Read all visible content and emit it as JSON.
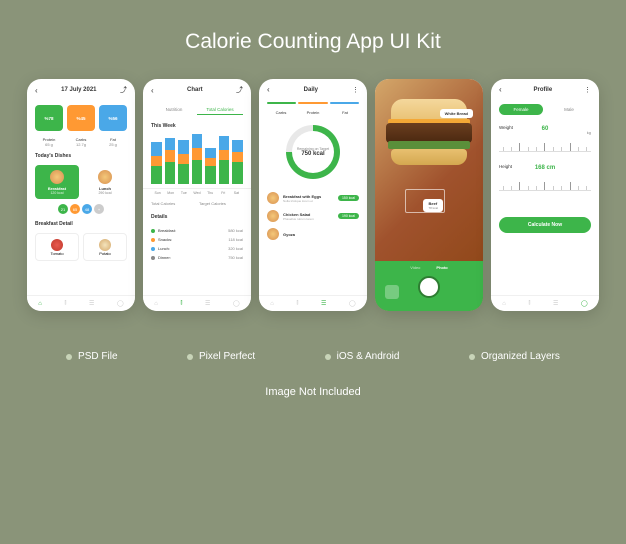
{
  "title": "Calorie Counting App UI Kit",
  "features": [
    "PSD File",
    "Pixel Perfect",
    "iOS & Android",
    "Organized Layers"
  ],
  "disclaimer": "Image Not Included",
  "screen1": {
    "date": "17 July 2021",
    "macros": [
      {
        "pct": "%78",
        "name": "Protein",
        "val": "65 g"
      },
      {
        "pct": "%45",
        "name": "Carbs",
        "val": "12.7g"
      },
      {
        "pct": "%56",
        "name": "Fat",
        "val": "25 g"
      }
    ],
    "today_title": "Today's Dishes",
    "dishes": [
      {
        "name": "Breakfast",
        "cal": "120 kcal"
      },
      {
        "name": "Lunch",
        "cal": "290 kcal"
      }
    ],
    "dots": [
      "21",
      "65",
      "48",
      "+"
    ],
    "bd_title": "Breakfast Detail",
    "bd": [
      {
        "name": "Tomato",
        "cal": ""
      },
      {
        "name": "Potato",
        "cal": ""
      }
    ]
  },
  "screen2": {
    "title": "Chart",
    "tabs": [
      "Nutrition",
      "Total Calories"
    ],
    "week_label": "This Week",
    "days": [
      "Sun",
      "Mon",
      "Tue",
      "Wed",
      "Thu",
      "Fri",
      "Sat"
    ],
    "total_label": "Total Calories",
    "total_val": "",
    "target_label": "Target Calories",
    "target_val": "",
    "details_title": "Details",
    "details": [
      {
        "name": "Breakfast:",
        "val": "580 kcal",
        "color": "#3db54a"
      },
      {
        "name": "Snacks:",
        "val": "118 kcal",
        "color": "#ff9933"
      },
      {
        "name": "Lunch:",
        "val": "320 kcal",
        "color": "#4aa8e8"
      },
      {
        "name": "Dinner:",
        "val": "750 kcal",
        "color": "#888"
      }
    ]
  },
  "screen3": {
    "title": "Daily",
    "macro_tabs": [
      "Carbs",
      "Protein",
      "Fat"
    ],
    "ring_label": "Remaining on Target",
    "ring_val": "750 kcal",
    "meals": [
      {
        "name": "Breakfast with Eggs",
        "desc": "Nulla tristique lorem et",
        "cal": "150 kcal"
      },
      {
        "name": "Chicken Salad",
        "desc": "Phasellus rutrum lorem",
        "cal": "190 kcal"
      },
      {
        "name": "Gyoza",
        "desc": "",
        "cal": ""
      }
    ]
  },
  "screen4": {
    "tags": [
      {
        "name": "White Bread",
        "cal": ""
      },
      {
        "name": "Beef",
        "cal": "78 kcal"
      }
    ],
    "cam_tabs": [
      "Video",
      "Photo"
    ]
  },
  "screen5": {
    "title": "Profile",
    "gender_tabs": [
      "Female",
      "Male"
    ],
    "weight_label": "Weight",
    "weight_val": "60",
    "weight_unit": "kg",
    "height_label": "Height",
    "height_val": "168 cm",
    "calc_btn": "Calculate Now"
  },
  "chart_data": {
    "type": "bar",
    "note": "Stacked bar chart, weekly nutrition. Values are estimated relative segment heights (arbitrary units, no y-axis shown).",
    "categories": [
      "Sun",
      "Mon",
      "Tue",
      "Wed",
      "Thu",
      "Fri",
      "Sat"
    ],
    "series": [
      {
        "name": "Breakfast",
        "color": "#3db54a",
        "values": [
          18,
          22,
          20,
          24,
          18,
          24,
          22
        ]
      },
      {
        "name": "Snacks",
        "color": "#ff9933",
        "values": [
          10,
          12,
          10,
          12,
          8,
          10,
          10
        ]
      },
      {
        "name": "Lunch",
        "color": "#4aa8e8",
        "values": [
          14,
          12,
          14,
          14,
          10,
          14,
          12
        ]
      }
    ]
  }
}
